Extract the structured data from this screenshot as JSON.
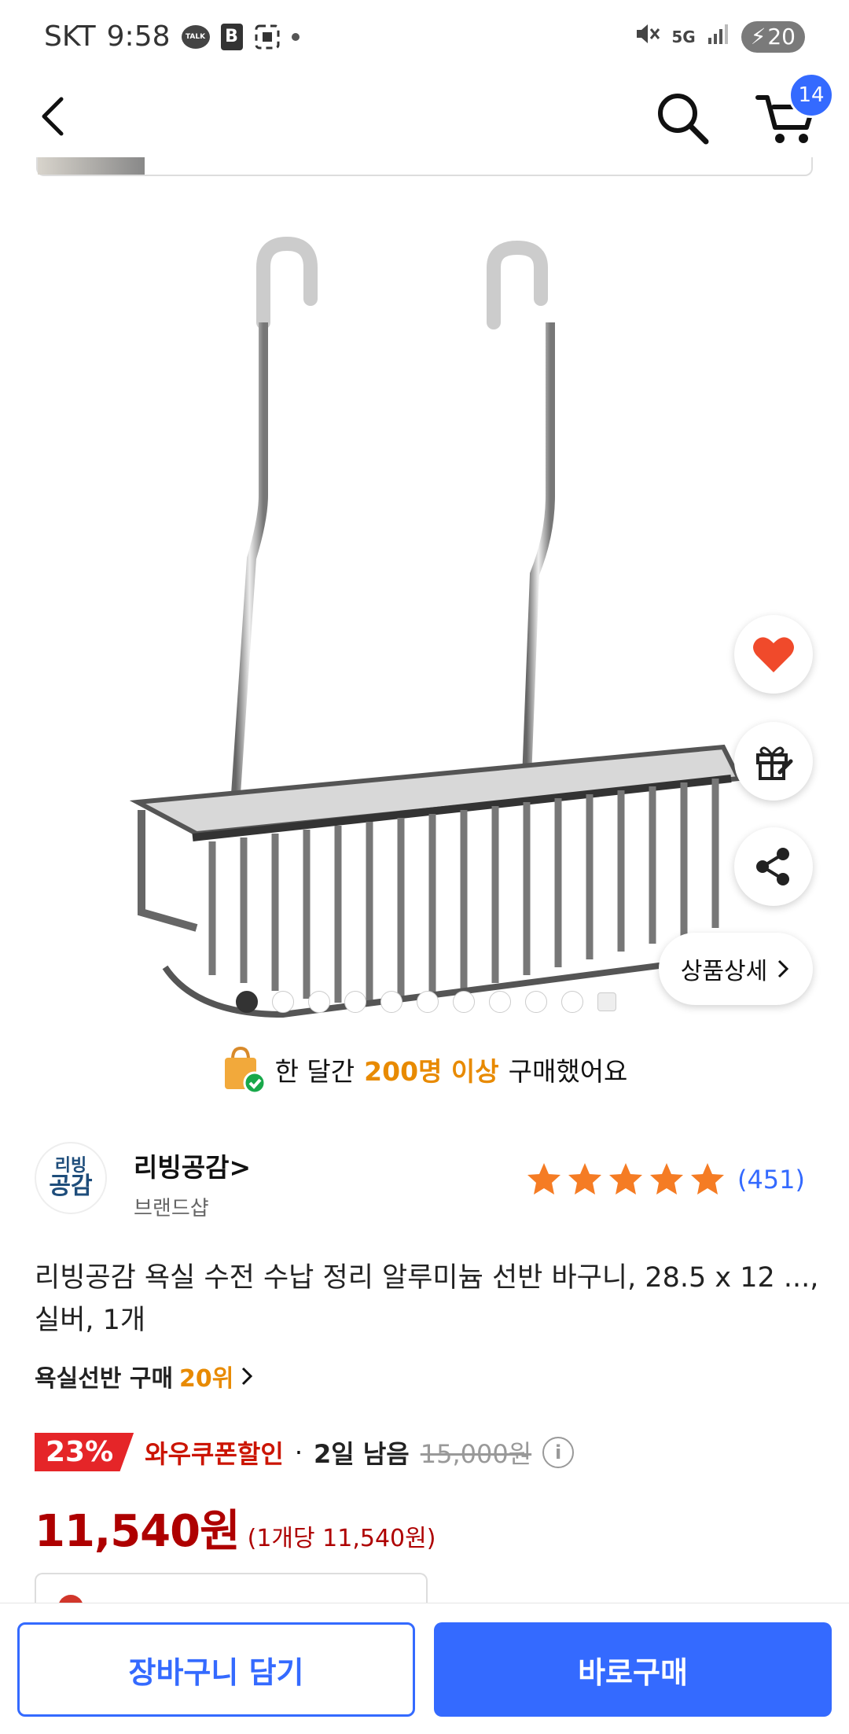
{
  "status_bar": {
    "carrier": "SKT",
    "time": "9:58",
    "talk_label": "TALK",
    "b_label": "B",
    "network": "5G",
    "battery": "20"
  },
  "header": {
    "cart_count": "14"
  },
  "purchase_notice": {
    "prefix": "한 달간",
    "highlight": "200명 이상",
    "suffix": "구매했어요"
  },
  "detail_button": {
    "label": "상품상세"
  },
  "seller": {
    "logo_line1": "리빙",
    "logo_line2": "공감",
    "name": "리빙공감",
    "type": "브랜드샵"
  },
  "rating": {
    "stars": 5,
    "review_count": "(451)"
  },
  "product": {
    "title": "리빙공감 욕실 수전 수납 정리 알루미늄 선반 바구니, 28.5 x 12 ..., 실버, 1개"
  },
  "category_rank": {
    "label": "욕실선반 구매",
    "rank": "20위"
  },
  "pricing": {
    "discount_rate": "23%",
    "coupon_label": "와우쿠폰할인",
    "separator": "·",
    "time_left": "2일 남음",
    "original_price": "15,000원",
    "final_price": "11,540원",
    "unit_price": "(1개당 11,540원)"
  },
  "bottom_bar": {
    "add_to_cart": "장바구니 담기",
    "buy_now": "바로구매"
  },
  "colors": {
    "accent_blue": "#346aff",
    "price_red": "#ae0000",
    "badge_red": "#e52528",
    "highlight_orange": "#e88a00",
    "star_orange": "#f57c24"
  },
  "carousel": {
    "total": 10,
    "active_index": 0
  }
}
